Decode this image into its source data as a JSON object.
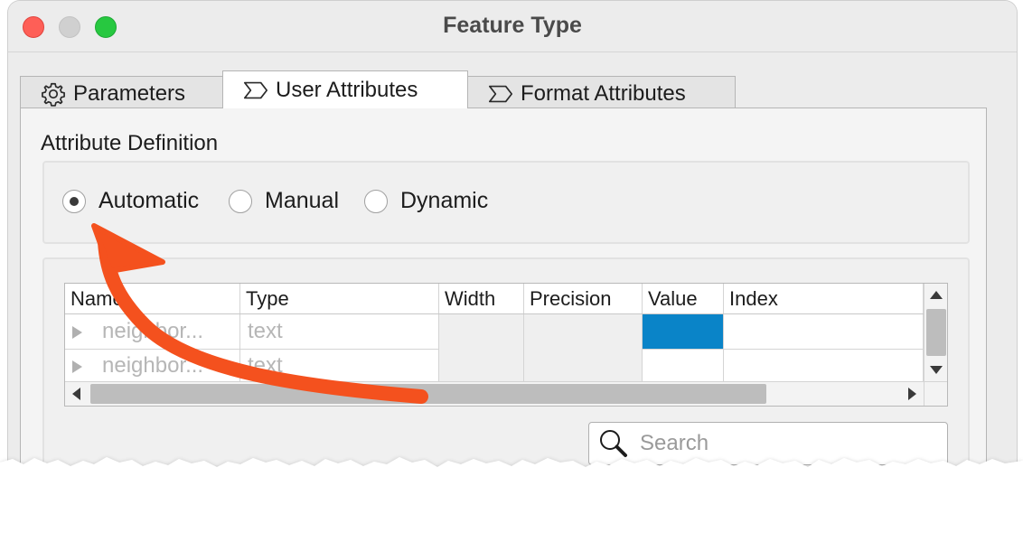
{
  "window": {
    "title": "Feature Type"
  },
  "tabs": [
    {
      "label": "Parameters",
      "icon": "gear-icon",
      "active": false
    },
    {
      "label": "User Attributes",
      "icon": "sigma-icon",
      "active": true
    },
    {
      "label": "Format Attributes",
      "icon": "sigma-icon",
      "active": false
    }
  ],
  "attribute_definition": {
    "label": "Attribute Definition",
    "options": [
      "Automatic",
      "Manual",
      "Dynamic"
    ],
    "selected": "Automatic"
  },
  "table": {
    "columns": [
      "Name",
      "Type",
      "Width",
      "Precision",
      "Value",
      "Index"
    ],
    "rows": [
      {
        "name": "neighbor...",
        "type": "text"
      },
      {
        "name": "neighbor...",
        "type": "text"
      }
    ]
  },
  "search": {
    "placeholder": "Search"
  },
  "colors": {
    "accent_arrow": "#f4511e",
    "selected_cell": "#0a84c8"
  }
}
